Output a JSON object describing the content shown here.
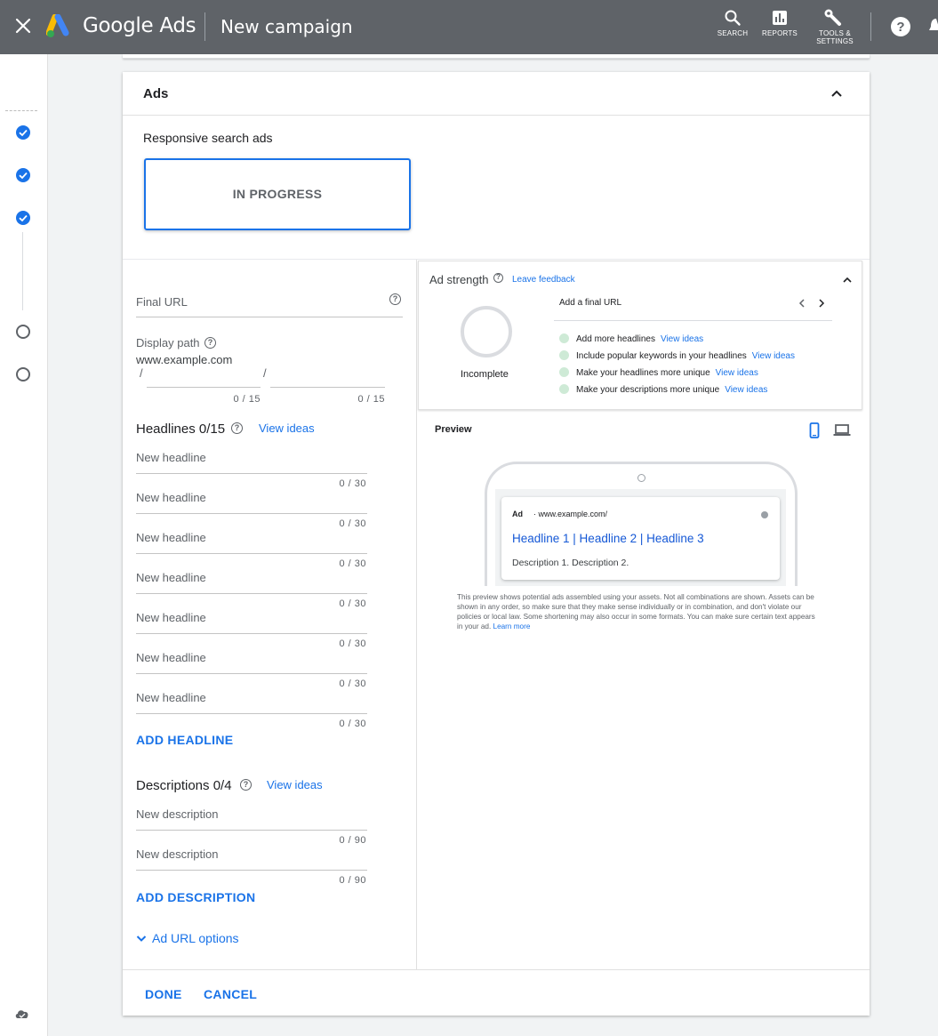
{
  "app": {
    "brand": "Google Ads",
    "title": "New campaign"
  },
  "toolbar": {
    "search": "SEARCH",
    "reports": "REPORTS",
    "tools_line1": "TOOLS &",
    "tools_line2": "SETTINGS"
  },
  "rail": {
    "steps": [
      "done",
      "done",
      "done",
      "open",
      "open"
    ]
  },
  "section": {
    "title": "Ads",
    "type_label": "Responsive search ads",
    "status": "IN PROGRESS"
  },
  "form": {
    "final_url": {
      "placeholder": "Final URL"
    },
    "display_path": {
      "label": "Display path",
      "domain": "www.example.com",
      "sep": "/",
      "counter1": "0 / 15",
      "counter2": "0 / 15"
    },
    "headlines": {
      "title": "Headlines 0/15",
      "view_ideas": "View ideas",
      "items": [
        {
          "placeholder": "New headline",
          "counter": "0 / 30"
        },
        {
          "placeholder": "New headline",
          "counter": "0 / 30"
        },
        {
          "placeholder": "New headline",
          "counter": "0 / 30"
        },
        {
          "placeholder": "New headline",
          "counter": "0 / 30"
        },
        {
          "placeholder": "New headline",
          "counter": "0 / 30"
        },
        {
          "placeholder": "New headline",
          "counter": "0 / 30"
        },
        {
          "placeholder": "New headline",
          "counter": "0 / 30"
        }
      ],
      "add_label": "ADD HEADLINE"
    },
    "descriptions": {
      "title": "Descriptions 0/4",
      "view_ideas": "View ideas",
      "items": [
        {
          "placeholder": "New description",
          "counter": "0 / 90"
        },
        {
          "placeholder": "New description",
          "counter": "0 / 90"
        }
      ],
      "add_label": "ADD DESCRIPTION"
    },
    "url_options": "Ad URL options"
  },
  "strength": {
    "title": "Ad strength",
    "feedback": "Leave feedback",
    "rating": "Incomplete",
    "current_tip": "Add a final URL",
    "tips": [
      {
        "text": "Add more headlines",
        "link": "View ideas"
      },
      {
        "text": "Include popular keywords in your headlines",
        "link": "View ideas"
      },
      {
        "text": "Make your headlines more unique",
        "link": "View ideas"
      },
      {
        "text": "Make your descriptions more unique",
        "link": "View ideas"
      }
    ]
  },
  "preview": {
    "title": "Preview",
    "ad_badge": "Ad",
    "ad_url": "· www.example.com/",
    "ad_headline": "Headline 1 | Headline 2 | Headline 3",
    "ad_description": "Description 1. Description 2.",
    "disclaimer": "This preview shows potential ads assembled using your assets. Not all combinations are shown. Assets can be shown in any order, so make sure that they make sense individually or in combination, and don't violate our policies or local law. Some shortening may also occur in some formats. You can make sure certain text appears in your ad.",
    "learn_more": "Learn more"
  },
  "footer": {
    "done": "DONE",
    "cancel": "CANCEL"
  },
  "colors": {
    "accent": "#1a73e8",
    "topbar": "#5f6368"
  }
}
